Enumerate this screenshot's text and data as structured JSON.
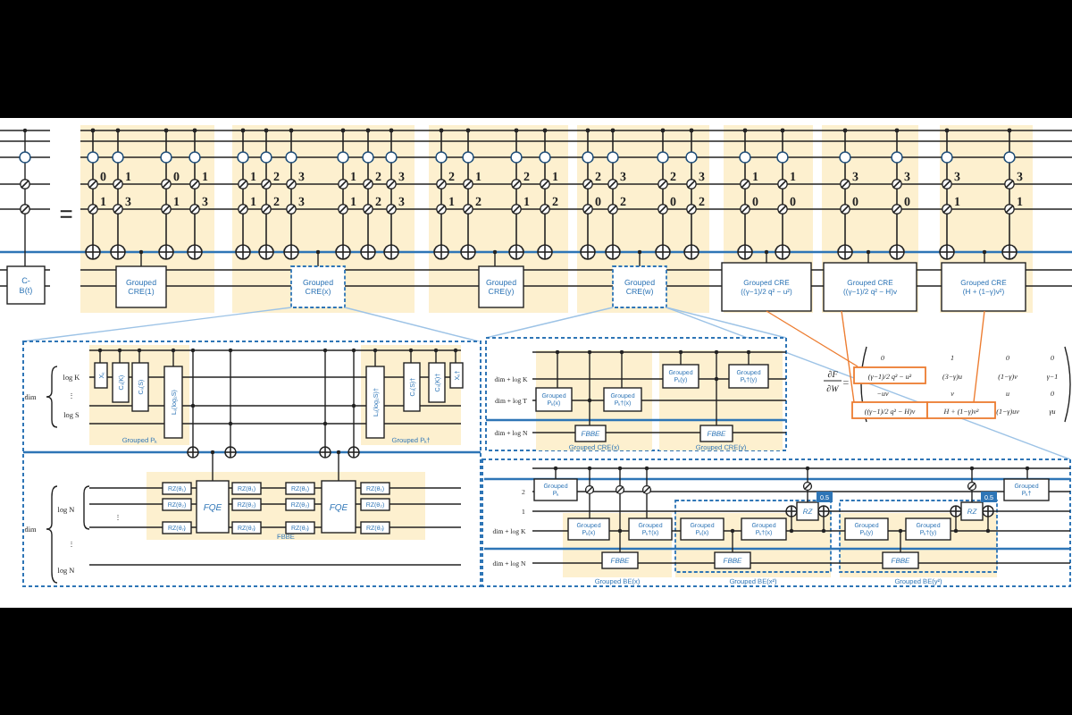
{
  "top_circuit": {
    "lhs_gate": {
      "lines": [
        "C-",
        "B(t)"
      ]
    },
    "equals": "=",
    "blocks": [
      {
        "columns": [
          {
            "upper": "0",
            "lower": "1"
          },
          {
            "upper": "1",
            "lower": "3"
          },
          {
            "upper": "0",
            "lower": "1"
          },
          {
            "upper": "1",
            "lower": "3"
          }
        ],
        "group": {
          "lines": [
            "Grouped",
            "CRE(1)"
          ],
          "dashed": false
        }
      },
      {
        "columns": [
          {
            "upper": "1",
            "lower": "1"
          },
          {
            "upper": "2",
            "lower": "2"
          },
          {
            "upper": "3",
            "lower": "3"
          },
          {
            "upper": "1",
            "lower": "1"
          },
          {
            "upper": "2",
            "lower": "2"
          },
          {
            "upper": "3",
            "lower": "3"
          }
        ],
        "group": {
          "lines": [
            "Grouped",
            "CRE(x)"
          ],
          "dashed": true
        }
      },
      {
        "columns": [
          {
            "upper": "2",
            "lower": "1"
          },
          {
            "upper": "1",
            "lower": "2"
          },
          {
            "upper": "2",
            "lower": "1"
          },
          {
            "upper": "1",
            "lower": "2"
          }
        ],
        "group": {
          "lines": [
            "Grouped",
            "CRE(y)"
          ],
          "dashed": false
        }
      },
      {
        "columns": [
          {
            "upper": "2",
            "lower": "0"
          },
          {
            "upper": "3",
            "lower": "2"
          },
          {
            "upper": "2",
            "lower": "0"
          },
          {
            "upper": "3",
            "lower": "2"
          }
        ],
        "group": {
          "lines": [
            "Grouped",
            "CRE(w)"
          ],
          "dashed": true
        }
      },
      {
        "columns": [
          {
            "upper": "1",
            "lower": "0"
          },
          {
            "upper": "1",
            "lower": "0"
          }
        ],
        "group": {
          "lines": [
            "Grouped CRE",
            "((γ−1)/2 q² − u²)"
          ],
          "dashed": false
        }
      },
      {
        "columns": [
          {
            "upper": "3",
            "lower": "0"
          },
          {
            "upper": "3",
            "lower": "0"
          }
        ],
        "group": {
          "lines": [
            "Grouped CRE",
            "((γ−1)/2 q² − H)v"
          ],
          "dashed": false
        }
      },
      {
        "columns": [
          {
            "upper": "3",
            "lower": "1"
          },
          {
            "upper": "3",
            "lower": "1"
          }
        ],
        "group": {
          "lines": [
            "Grouped CRE",
            "(H + (1−γ)v²)"
          ],
          "dashed": false
        }
      }
    ]
  },
  "left_expansion": {
    "register_labels": [
      "dim",
      "log K",
      "⋮",
      "log S",
      "dim",
      "log N",
      "⋮",
      "log N",
      "⋮"
    ],
    "groups": [
      "Grouped Pₖ",
      "Grouped Pₖ†",
      "FBBE"
    ],
    "gates": [
      "Xₖ",
      "Cₖ(K)",
      "Cₖ(S)",
      "Lₖ(log₂S)",
      "Lₖ(log₂S)†",
      "Cₖ(S)†",
      "Cₖ(K)†",
      "Xₖ†"
    ],
    "fqe_gates": [
      "FQE",
      "FQE"
    ],
    "rotation_gates": [
      "RZ(θ₁)",
      "RZ(θ₂)",
      "RZ(θₙ)",
      "RZ(θ₁)",
      "RZ(θ₂)",
      "RZ(θₙ)",
      "RZ(θ₁)",
      "RZ(θ₂)",
      "RZ(θₙ)",
      "RZ(θ₁)",
      "RZ(θ₂)",
      "RZ(θₙ)"
    ]
  },
  "middle_expansion": {
    "register_labels": [
      "dim + log K",
      "dim + log T",
      "dim + log N"
    ],
    "groups": [
      "Grouped CRE(x)",
      "Grouped CRE(y)"
    ],
    "gates": [
      {
        "lines": [
          "Grouped",
          "Pₖ(x)"
        ]
      },
      {
        "lines": [
          "Grouped",
          "Pₖ†(x)"
        ]
      },
      {
        "lines": [
          "Grouped",
          "Pₖ(y)"
        ]
      },
      {
        "lines": [
          "Grouped",
          "Pₖ†(y)"
        ]
      }
    ],
    "fbbe_gates": [
      "FBBE",
      "FBBE"
    ]
  },
  "jacobian": {
    "numerator": "∂F",
    "denominator": "∂W",
    "equals": "=",
    "rows": [
      [
        {
          "text": "0",
          "highlighted": false
        },
        {
          "text": "1",
          "highlighted": false
        },
        {
          "text": "0",
          "highlighted": false
        },
        {
          "text": "0",
          "highlighted": false
        }
      ],
      [
        {
          "text": "(γ−1)/2 q² − u²",
          "highlighted": true
        },
        {
          "text": "(3−γ)u",
          "highlighted": false
        },
        {
          "text": "(1−γ)v",
          "highlighted": false
        },
        {
          "text": "γ−1",
          "highlighted": false
        }
      ],
      [
        {
          "text": "−uv",
          "highlighted": false
        },
        {
          "text": "v",
          "highlighted": false
        },
        {
          "text": "u",
          "highlighted": false
        },
        {
          "text": "0",
          "highlighted": false
        }
      ],
      [
        {
          "text": "((γ−1)/2 q² − H)v",
          "highlighted": true
        },
        {
          "text": "H + (1−γ)v²",
          "highlighted": true
        },
        {
          "text": "(1−γ)uv",
          "highlighted": false
        },
        {
          "text": "γu",
          "highlighted": false
        }
      ]
    ]
  },
  "bottom_right_expansion": {
    "register_labels": [
      "2",
      "1",
      "dim + log K",
      "dim + log N"
    ],
    "groups": [
      "Grouped BE(x)",
      "Grouped BE(x²)",
      "Grouped BE(y²)"
    ],
    "gates": [
      {
        "lines": [
          "Grouped",
          "Pₖ"
        ]
      },
      {
        "lines": [
          "Grouped",
          "Pₖ(x)"
        ]
      },
      {
        "lines": [
          "Grouped",
          "Pₖ†(x)"
        ]
      },
      {
        "lines": [
          "Grouped",
          "Pₖ(x)"
        ]
      },
      {
        "lines": [
          "Grouped",
          "Pₖ†(x)"
        ]
      },
      {
        "lines": [
          "Grouped",
          "Pₖ(y)"
        ]
      },
      {
        "lines": [
          "Grouped",
          "Pₖ†(y)"
        ]
      },
      {
        "lines": [
          "Grouped",
          "Pₖ†"
        ]
      }
    ],
    "fbbe_gates": [
      "FBBE",
      "FBBE",
      "FBBE"
    ],
    "rz_gates": [
      "RZ",
      "RZ"
    ],
    "badges": [
      "0.5",
      "0.5"
    ]
  }
}
